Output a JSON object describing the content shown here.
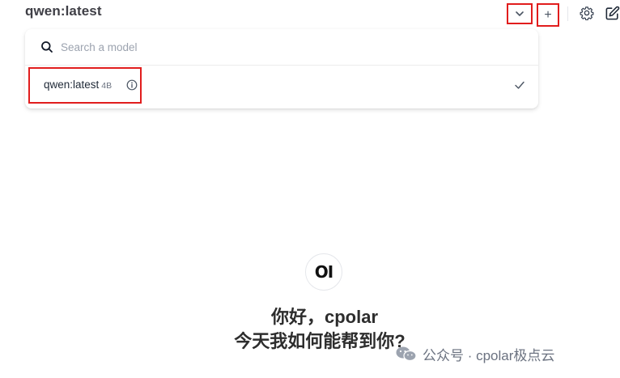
{
  "header": {
    "model_title": "qwen:latest",
    "plus_label": "+"
  },
  "dropdown": {
    "search_placeholder": "Search a model",
    "search_value": "",
    "items": [
      {
        "name": "qwen:latest",
        "size": "4B",
        "selected": true
      }
    ]
  },
  "center": {
    "logo_text": "OI",
    "greeting": "你好，cpolar",
    "question": "今天我如何能帮到你?"
  },
  "watermark": {
    "text": "公众号 · cpolar极点云"
  },
  "colors": {
    "highlight": "#e11d1d",
    "text": "#1f2937",
    "muted": "#9ca3af"
  },
  "icons": [
    "chevron-down-icon",
    "plus-icon",
    "gear-icon",
    "edit-icon",
    "search-icon",
    "info-icon",
    "check-icon",
    "wechat-icon"
  ]
}
